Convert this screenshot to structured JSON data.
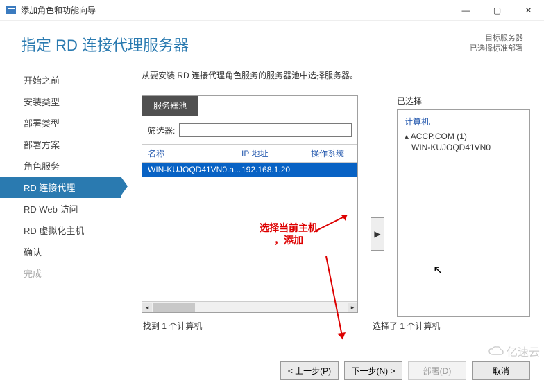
{
  "window": {
    "title": "添加角色和功能向导",
    "min": "—",
    "max": "▢",
    "close": "✕"
  },
  "header": {
    "title": "指定 RD 连接代理服务器",
    "right1": "目标服务器",
    "right2": "已选择标准部署"
  },
  "sidebar": {
    "items": [
      "开始之前",
      "安装类型",
      "部署类型",
      "部署方案",
      "角色服务",
      "RD 连接代理",
      "RD Web 访问",
      "RD 虚拟化主机",
      "确认",
      "完成"
    ],
    "selectedIndex": 5,
    "disabledIndex": 9
  },
  "main": {
    "instruction": "从要安装 RD 连接代理角色服务的服务器池中选择服务器。",
    "pool_tab": "服务器池",
    "filter_label": "筛选器:",
    "filter_value": "",
    "cols": {
      "name": "名称",
      "ip": "IP 地址",
      "os": "操作系统"
    },
    "rows": [
      {
        "name": "WIN-KUJOQD41VN0.a...",
        "ip": "192.168.1.20",
        "os": ""
      }
    ],
    "selected_label": "已选择",
    "tree_header": "计算机",
    "tree_node1": "▴ ACCP.COM (1)",
    "tree_node2": "WIN-KUJOQD41VN0",
    "count_left": "找到 1 个计算机",
    "count_right": "选择了 1 个计算机",
    "arrow": "▶",
    "annotation": "选择当前主机\n，添加"
  },
  "footer": {
    "prev": "< 上一步(P)",
    "next": "下一步(N) >",
    "deploy": "部署(D)",
    "cancel": "取消"
  },
  "watermark": "亿速云"
}
